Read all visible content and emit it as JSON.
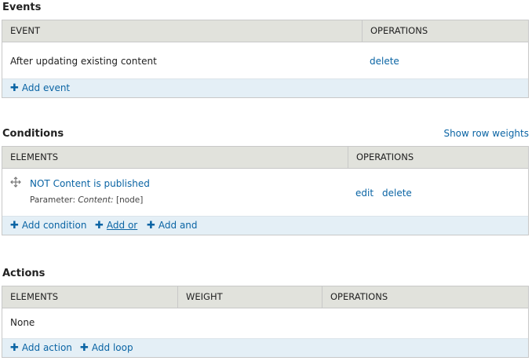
{
  "events": {
    "title": "Events",
    "headers": [
      "EVENT",
      "OPERATIONS"
    ],
    "row": {
      "label": "After updating existing content",
      "delete": "delete"
    },
    "footer": {
      "add_event": "Add event"
    }
  },
  "conditions": {
    "title": "Conditions",
    "show_row_weights": "Show row weights",
    "headers": [
      "ELEMENTS",
      "OPERATIONS"
    ],
    "row": {
      "label": "NOT Content is published",
      "param_prefix": "Parameter:",
      "param_name": "Content:",
      "param_value": "[node]",
      "edit": "edit",
      "delete": "delete"
    },
    "footer": {
      "add_condition": "Add condition",
      "add_or": "Add or",
      "add_and": "Add and"
    }
  },
  "actions": {
    "title": "Actions",
    "headers": [
      "ELEMENTS",
      "WEIGHT",
      "OPERATIONS"
    ],
    "row": {
      "label": "None"
    },
    "footer": {
      "add_action": "Add action",
      "add_loop": "Add loop"
    }
  },
  "icons": {
    "add": "plus-icon",
    "drag": "drag-handle-icon"
  },
  "colors": {
    "link": "#0a64a4",
    "header_bg": "#e1e2dc",
    "footer_bg": "#e4eff6",
    "border": "#c8c8c8"
  }
}
